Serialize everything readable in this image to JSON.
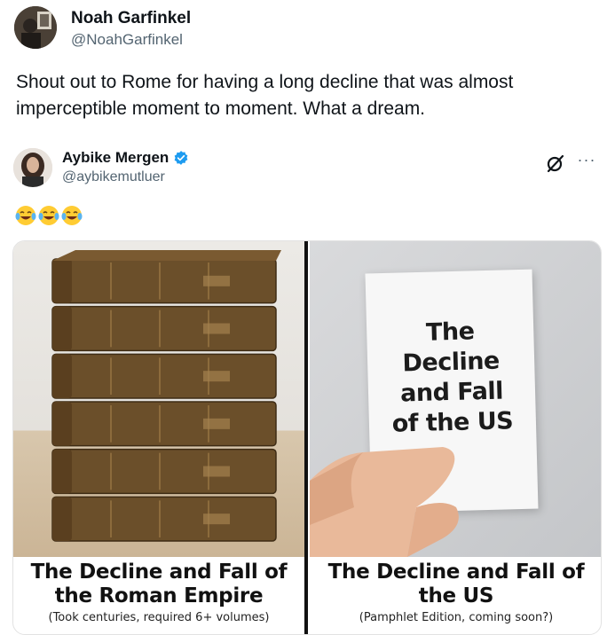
{
  "tweet": {
    "author_name": "Noah Garfinkel",
    "author_handle": "@NoahGarfinkel",
    "text": "Shout out to Rome for having a long decline that was almost imperceptible moment to moment. What a dream."
  },
  "quoted_tweet": {
    "author_name": "Aybike Mergen",
    "author_handle": "@aybikemutluer",
    "verified": true,
    "emojis": [
      "face-with-tears-of-joy",
      "face-with-tears-of-joy",
      "face-with-tears-of-joy"
    ],
    "more_label": "···"
  },
  "meme": {
    "left": {
      "title": "The Decline and Fall of\nthe Roman Empire",
      "subtitle": "(Took centuries, required 6+ volumes)",
      "volume_count": 6
    },
    "right": {
      "card_text": "The\nDecline\nand Fall\nof the US",
      "title": "The Decline and Fall of\nthe US",
      "subtitle": "(Pamphlet Edition, coming soon?)"
    }
  },
  "colors": {
    "verified_badge": "#1d9bf0",
    "text_primary": "#0f1419",
    "text_secondary": "#536471",
    "book_leather": "#6b4f2a"
  }
}
